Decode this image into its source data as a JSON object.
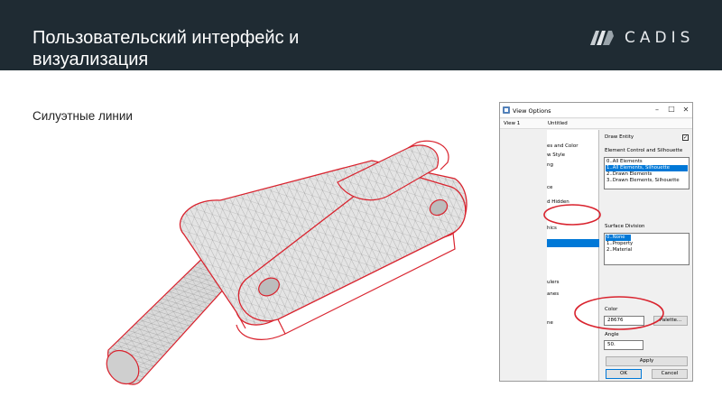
{
  "header": {
    "title_line1": "Пользовательский интерфейс и",
    "title_line2": "визуализация",
    "logo_text": "CADIS",
    "bg_color": "#1f2b33"
  },
  "subtitle": "Силуэтные линии",
  "accent_color": "#d9232e",
  "model": {
    "description_icon": "3d-mesh-chain-link-model",
    "silhouette_color": "#d9232e"
  },
  "dialog": {
    "title": "View Options",
    "tabs": [
      "View 1",
      "Untitled"
    ],
    "left_tree": [
      "es and Color",
      "w Style",
      "ng",
      "ce",
      "d Hidden",
      "hics",
      "",
      "ulers",
      "anes",
      "",
      "ne"
    ],
    "draw_entity_label": "Draw Entity",
    "draw_entity_checked": true,
    "element_control_label": "Element Control and Silhouette",
    "element_control_options": [
      "0..All Elements",
      "1..All Elements, Silhouette",
      "2..Drawn Elements",
      "3..Drawn Elements, Silhouette"
    ],
    "element_control_selected": 1,
    "surface_division_label": "Surface Division",
    "surface_division_options": [
      "0..None",
      "1..Property",
      "2..Material"
    ],
    "surface_division_selected": 0,
    "color_label": "Color",
    "color_value": "28676",
    "palette_button": "Palette...",
    "angle_label": "Angle",
    "angle_value": "50.",
    "apply_button": "Apply",
    "ok_button": "OK",
    "cancel_button": "Cancel"
  }
}
